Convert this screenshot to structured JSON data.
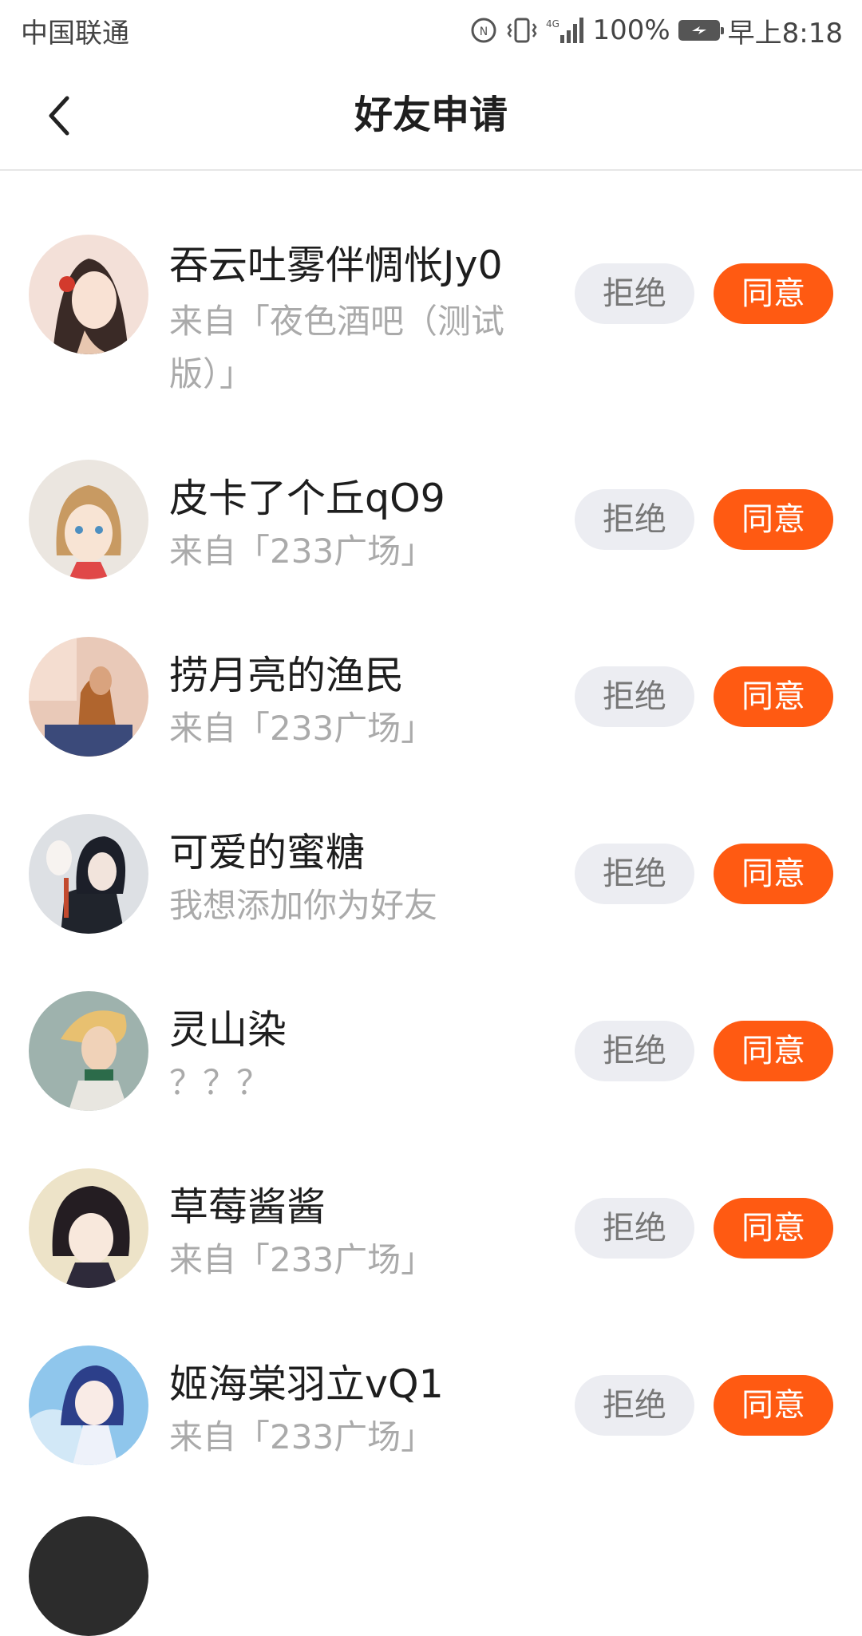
{
  "status_bar": {
    "carrier": "中国联通",
    "network": "4G",
    "battery": "100%",
    "time": "早上8:18"
  },
  "header": {
    "title": "好友申请",
    "back_icon": "chevron-left-icon"
  },
  "buttons": {
    "reject": "拒绝",
    "accept": "同意"
  },
  "colors": {
    "accent": "#ff5a12",
    "reject_bg": "#ecedf2",
    "secondary_text": "#aaaaaa"
  },
  "requests": [
    {
      "name": "吞云吐雾伴惆怅Jy0",
      "source": "来自「夜色酒吧（测试版）」",
      "reject": "拒绝",
      "accept": "同意"
    },
    {
      "name": "皮卡了个丘qO9",
      "source": "来自「233广场」",
      "reject": "拒绝",
      "accept": "同意"
    },
    {
      "name": "捞月亮的渔民",
      "source": "来自「233广场」",
      "reject": "拒绝",
      "accept": "同意"
    },
    {
      "name": "可爱的蜜糖",
      "source": "我想添加你为好友",
      "reject": "拒绝",
      "accept": "同意"
    },
    {
      "name": "灵山染",
      "source": "？？？",
      "reject": "拒绝",
      "accept": "同意"
    },
    {
      "name": "草莓酱酱",
      "source": "来自「233广场」",
      "reject": "拒绝",
      "accept": "同意"
    },
    {
      "name": "姬海棠羽立vQ1",
      "source": "来自「233广场」",
      "reject": "拒绝",
      "accept": "同意"
    }
  ]
}
